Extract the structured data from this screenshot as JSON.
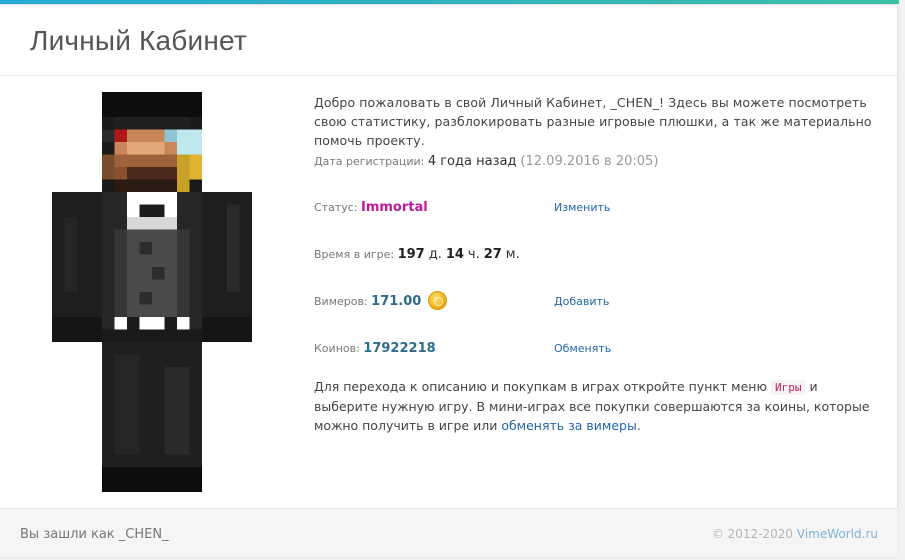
{
  "page": {
    "title": "Личный Кабинет"
  },
  "skin": {
    "icon": "minecraft-skin-avatar"
  },
  "profile": {
    "welcome_text": "Добро пожаловать в свой Личный Кабинет, _CHEN_! Здесь вы можете посмотреть свою статистику, разблокировать разные игровые плюшки, а так же материально помочь проекту.",
    "registration": {
      "label": "Дата регистрации",
      "value": "4 года назад",
      "date": "(12.09.2016 в 20:05)"
    },
    "status": {
      "label": "Статус",
      "value": "Immortal",
      "action": "Изменить",
      "color": "#c0199c"
    },
    "playtime": {
      "label": "Время в игре",
      "days": "197",
      "days_unit": "д.",
      "hours": "14",
      "hours_unit": "ч.",
      "minutes": "27",
      "minutes_unit": "м."
    },
    "vimers": {
      "label": "Вимеров",
      "value": "171.00",
      "action": "Добавить",
      "icon": "gold-coin-icon"
    },
    "coins": {
      "label": "Коинов",
      "value": "17922218",
      "action": "Обменять"
    },
    "info": {
      "part1": "Для перехода к описанию и покупкам в играх откройте пункт меню",
      "menu_tag": "Игры",
      "part2": "и выберите нужную игру. В мини-играх все покупки совершаются за коины, которые можно получить в игре или",
      "link": "обменять за вимеры",
      "end": "."
    }
  },
  "footer": {
    "logged_in": "Вы зашли как _CHEN_",
    "copyright": "© 2012-2020",
    "site": "VimeWorld.ru"
  },
  "colors": {
    "accent": "#2266aa",
    "status_immortal": "#c0199c",
    "value_blue": "#2d6a8e"
  }
}
